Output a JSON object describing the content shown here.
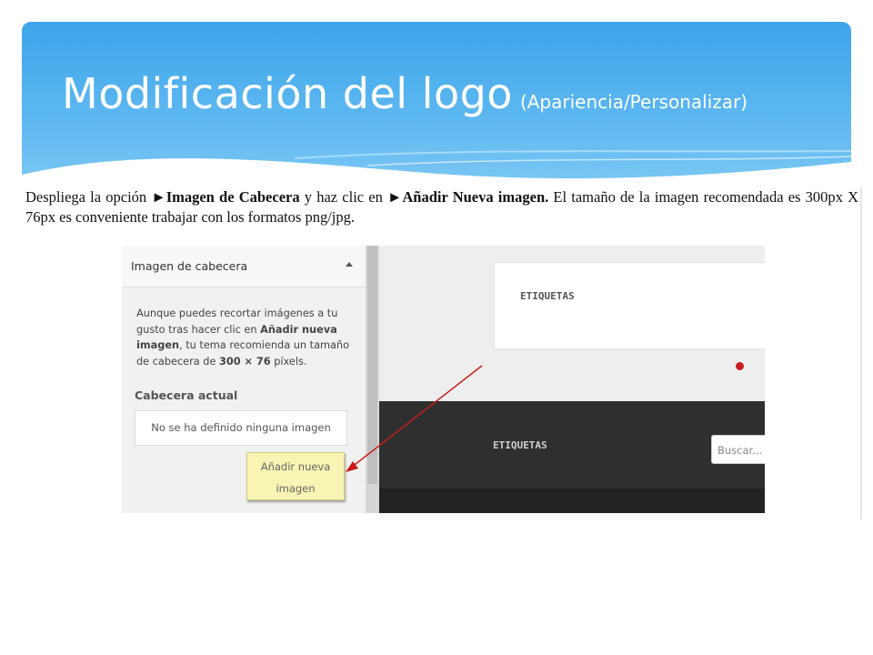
{
  "slide": {
    "title": "Modificación del logo",
    "subtitle": "(Apariencia/Personalizar)"
  },
  "instruction": {
    "part1": "Despliega la opción ",
    "part2": "Imagen de Cabecera",
    "part3": " y haz clic en ",
    "part4": "Añadir Nueva imagen.",
    "part5": " El tamaño de la imagen recomendada es 300px X 76px es conveniente trabajar con los formatos png/jpg.",
    "arrow_glyph": "►"
  },
  "panel": {
    "section_title": "Imagen de cabecera",
    "description_1": "Aunque puedes recortar imágenes a tu gusto tras hacer clic en ",
    "description_bold_1": "Añadir nueva imagen",
    "description_2": ", tu tema recomienda un tamaño de cabecera de ",
    "description_bold_2": "300 × 76",
    "description_3": " píxels.",
    "current_label": "Cabecera actual",
    "no_image_text": "No se ha definido ninguna imagen",
    "add_button_line1": "Añadir nueva",
    "add_button_line2": "imagen"
  },
  "preview": {
    "card_title": "ETIQUETAS",
    "footer_title": "ETIQUETAS",
    "search_placeholder": "Buscar..."
  },
  "colors": {
    "header_blue": "#3da5ea",
    "button_yellow": "#f7f4b4",
    "pointer_red": "#c81c1c"
  }
}
